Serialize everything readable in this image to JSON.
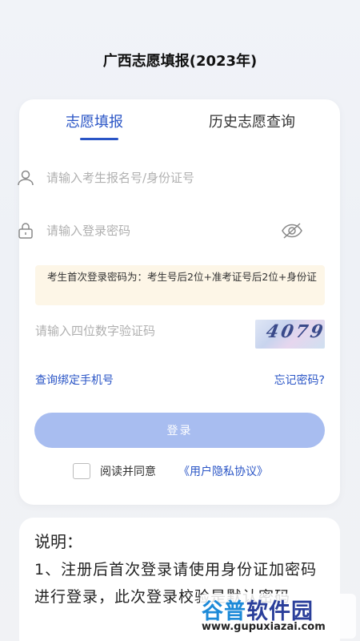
{
  "header": {
    "title": "广西志愿填报(2023年)"
  },
  "tabs": [
    {
      "label": "志愿填报",
      "active": true
    },
    {
      "label": "历史志愿查询",
      "active": false
    }
  ],
  "form": {
    "username_placeholder": "请输入考生报名号/身份证号",
    "password_placeholder": "请输入登录密码",
    "notice": "考生首次登录密码为：考生号后2位+准考证号后2位+身份证",
    "captcha_placeholder": "请输入四位数字验证码",
    "captcha_text": "4079",
    "bind_phone_link": "查询绑定手机号",
    "forgot_link": "忘记密码?",
    "login_label": "登录",
    "agree_text": "阅读并同意",
    "agree_link": "《用户隐私协议》"
  },
  "notes": {
    "title": "说明：",
    "body": "1、注册后首次登录请使用身份证加密码进行登录，此次登录校验是默认密码"
  },
  "watermark": {
    "brand_part1": "谷普",
    "brand_part2": "软件园",
    "url": "www.gupuxiazai.com"
  },
  "colors": {
    "accent": "#2a55c6",
    "button_disabled": "#a8bdf0",
    "notice_bg": "#fdf6e7"
  },
  "icons": [
    "user-icon",
    "lock-icon",
    "eye-off-icon"
  ]
}
